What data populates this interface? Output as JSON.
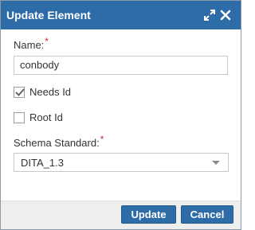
{
  "dialog": {
    "title": "Update Element"
  },
  "form": {
    "name_label": "Name:",
    "name_required_mark": "*",
    "name_value": "conbody",
    "needs_id_label": "Needs Id",
    "needs_id_checked": true,
    "root_id_label": "Root Id",
    "root_id_checked": false,
    "schema_label": "Schema Standard:",
    "schema_required_mark": "*",
    "schema_value": "DITA_1.3"
  },
  "footer": {
    "update_label": "Update",
    "cancel_label": "Cancel"
  },
  "colors": {
    "titlebar": "#2e6ca7",
    "button": "#2e6ca7",
    "required": "#d22b2b"
  },
  "icons": [
    "expand-icon",
    "close-icon",
    "checkmark-icon",
    "dropdown-arrow-icon"
  ]
}
